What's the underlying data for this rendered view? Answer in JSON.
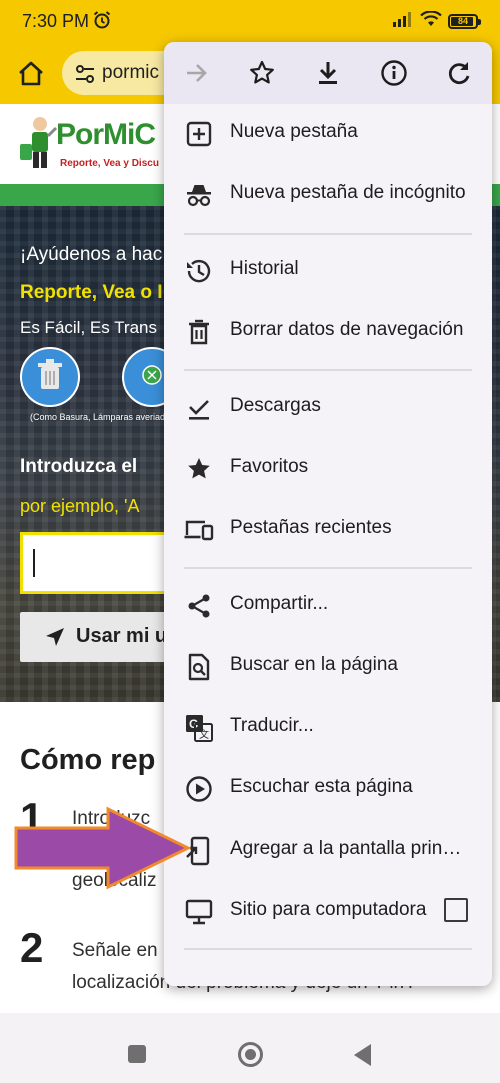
{
  "status_bar": {
    "time": "7:30 PM",
    "battery": "84"
  },
  "url_bar": {
    "url_text": "pormic"
  },
  "website": {
    "logo_word": "PorMiC",
    "logo_tagline": "Reporte, Vea y Discu",
    "hero": {
      "line1": "¡Ayúdenos a hac",
      "line2": "Reporte, Vea o I",
      "line3": "Es Fácil,  Es Trans",
      "icon_caption": "(Como Basura, Lámparas averiad",
      "line4": "Introduzca el",
      "line5": "por ejemplo, 'A",
      "locate_button": "Usar mi u"
    },
    "section_title": "Cómo rep",
    "steps": [
      {
        "number": "1",
        "line1": "Introduzc",
        "line2": "geolocaliz"
      },
      {
        "number": "2",
        "line1": "Señale en",
        "line2": "localización del problema y deje un 'Pin'."
      }
    ]
  },
  "menu": {
    "toolbar": [
      {
        "name": "forward-icon"
      },
      {
        "name": "star-icon"
      },
      {
        "name": "download-icon"
      },
      {
        "name": "info-icon"
      },
      {
        "name": "refresh-icon"
      }
    ],
    "items": [
      {
        "label": "Nueva pestaña",
        "icon": "new-tab-icon"
      },
      {
        "label": "Nueva pestaña de incógnito",
        "icon": "incognito-icon"
      },
      {
        "label": "Historial",
        "icon": "history-icon"
      },
      {
        "label": "Borrar datos de navegación",
        "icon": "trash-icon"
      },
      {
        "label": "Descargas",
        "icon": "downloads-icon"
      },
      {
        "label": "Favoritos",
        "icon": "star-icon"
      },
      {
        "label": "Pestañas recientes",
        "icon": "devices-icon"
      },
      {
        "label": "Compartir...",
        "icon": "share-icon"
      },
      {
        "label": "Buscar en la página",
        "icon": "find-in-page-icon"
      },
      {
        "label": "Traducir...",
        "icon": "translate-icon"
      },
      {
        "label": "Escuchar esta página",
        "icon": "play-icon"
      },
      {
        "label": "Agregar a la pantalla principal",
        "icon": "add-to-home-icon"
      },
      {
        "label": "Sitio para computadora",
        "icon": "desktop-icon"
      }
    ]
  },
  "colors": {
    "chrome_yellow": "#f5c800",
    "site_green": "#3aa64a",
    "hero_yellow": "#f1e100",
    "arrow_purple": "#9b4aa8",
    "arrow_outline": "#f08a2c"
  }
}
